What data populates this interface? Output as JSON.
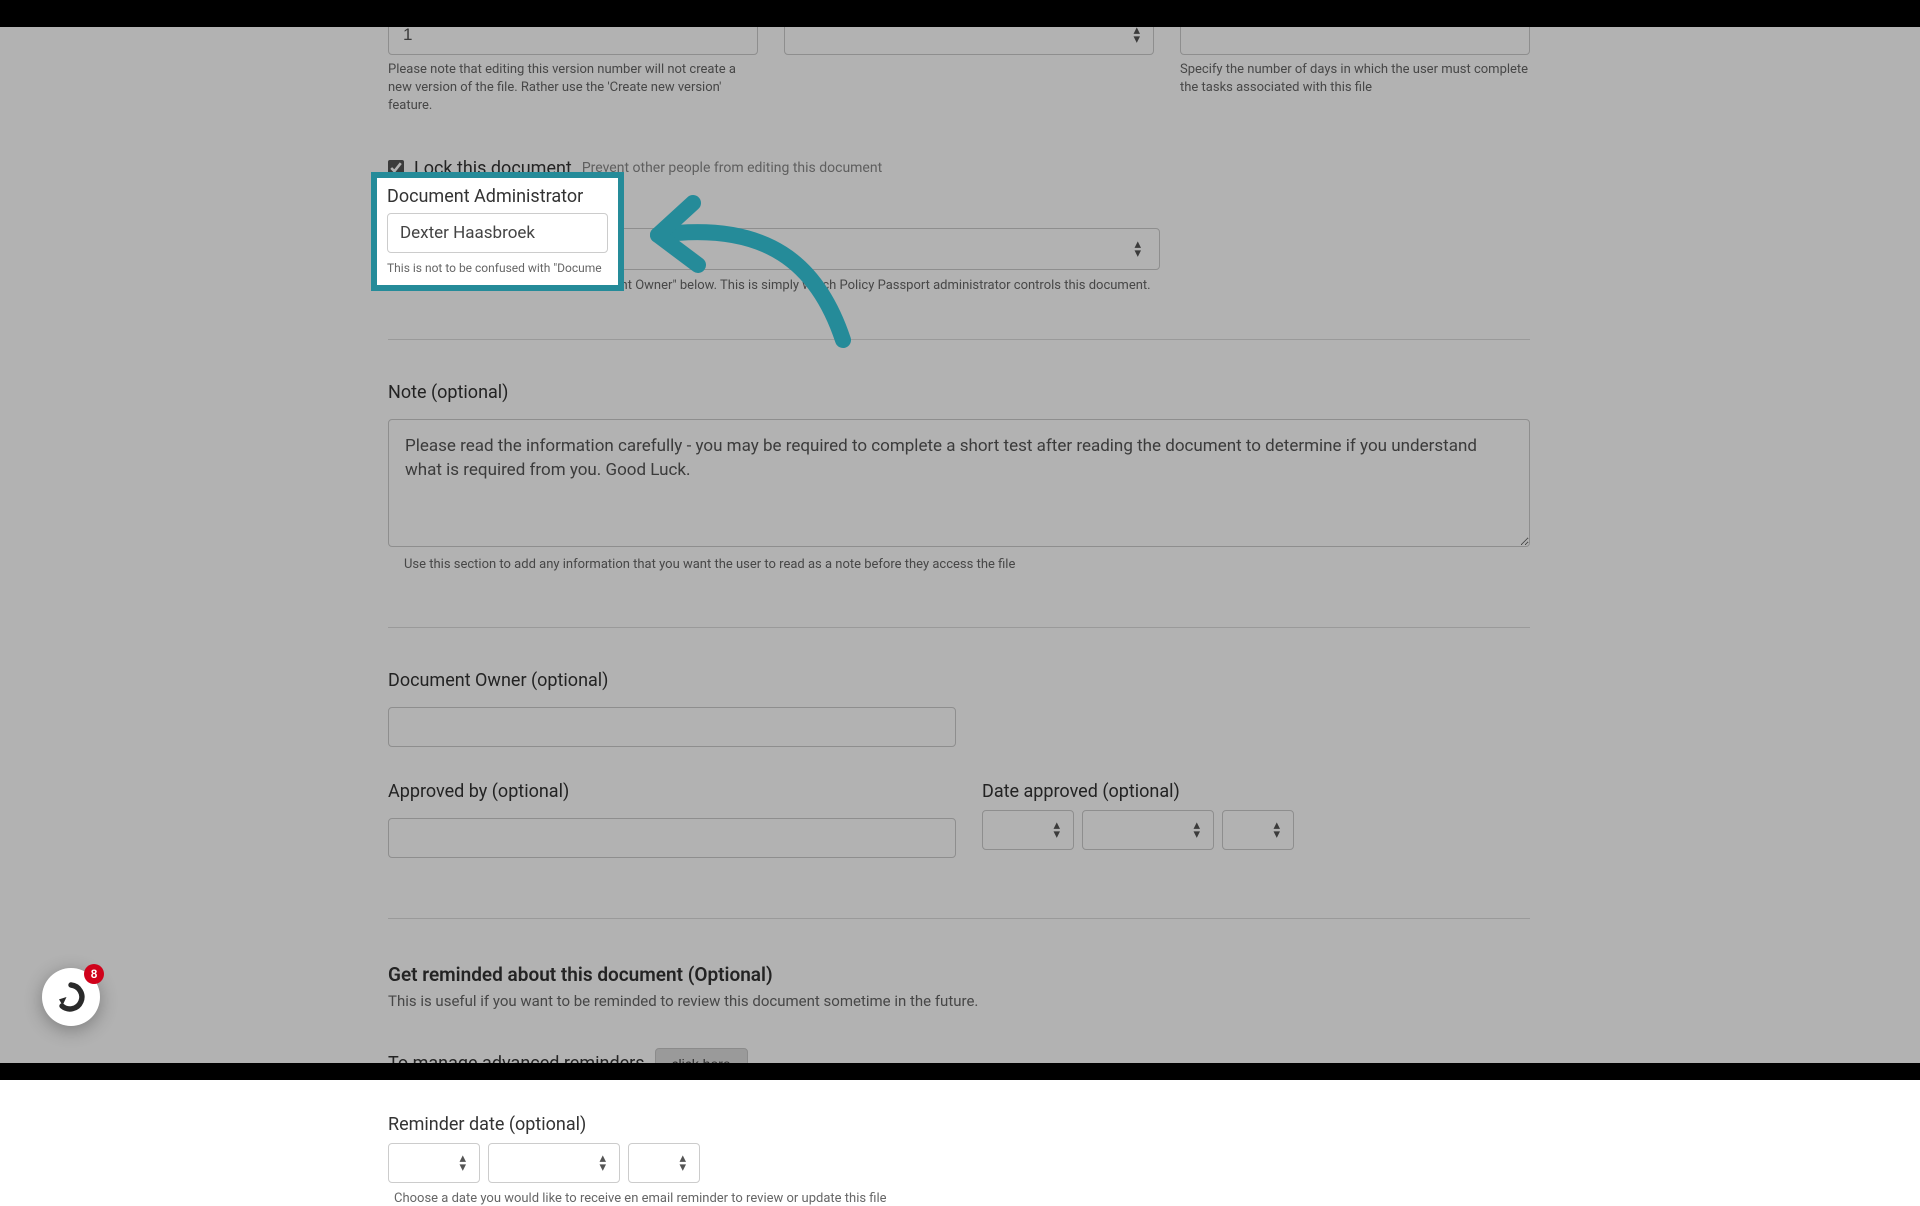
{
  "version_input": {
    "value": "1",
    "help": "Please note that editing this version number will not create a new version of the file. Rather use the 'Create new version' feature."
  },
  "days_col": {
    "help": "Specify the number of days in which the user must complete the tasks associated with this file"
  },
  "lock": {
    "label": "Lock this document",
    "help": "Prevent other people from editing this document",
    "checked": true
  },
  "admin": {
    "label": "Document Administrator",
    "value": "Dexter Haasbroek",
    "help": "This is not to be confused with \"Document Owner\" below. This is simply which Policy Passport administrator controls this document.",
    "highlight_help": "This is not to be confused with \"Docume"
  },
  "note": {
    "label": "Note (optional)",
    "value": "Please read the information carefully - you may be required to complete a short test after reading the document to determine if you understand what is required from you. Good Luck.",
    "help": "Use this section to add any information that you want the user to read as a note before they access the file"
  },
  "owner": {
    "label": "Document Owner (optional)",
    "value": ""
  },
  "approved_by": {
    "label": "Approved by (optional)",
    "value": ""
  },
  "date_approved": {
    "label": "Date approved (optional)"
  },
  "reminder": {
    "heading": "Get reminded about this document (Optional)",
    "sub": "This is useful if you want to be reminded to review this document sometime in the future.",
    "manage_label": "To manage advanced reminders",
    "click_here": "click here",
    "date_label": "Reminder date (optional)",
    "date_help": "Choose a date you would like to receive en email reminder to review or update this file"
  },
  "chat": {
    "badge": "8"
  }
}
